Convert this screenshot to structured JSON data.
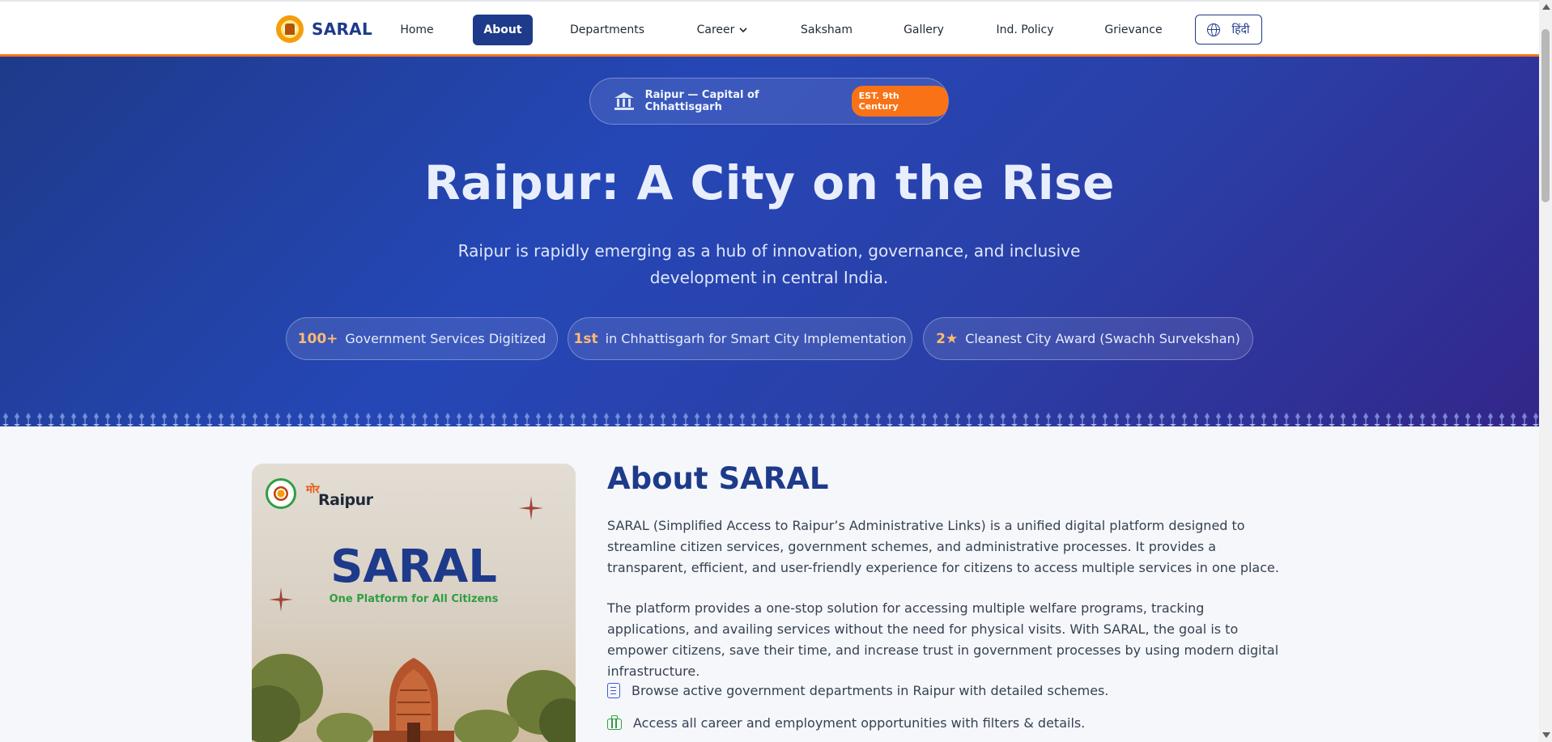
{
  "brand": {
    "name": "SARAL"
  },
  "nav": {
    "items": [
      {
        "label": "Home"
      },
      {
        "label": "About",
        "active": true
      },
      {
        "label": "Departments"
      },
      {
        "label": "Career",
        "has_dropdown": true
      },
      {
        "label": "Saksham"
      },
      {
        "label": "Gallery"
      },
      {
        "label": "Ind. Policy"
      },
      {
        "label": "Grievance"
      }
    ],
    "lang_button": {
      "label": "हिंदी",
      "icon": "globe-icon"
    }
  },
  "hero": {
    "badge_text": "Raipur — Capital of Chhattisgarh",
    "badge_pill": "EST. 9th Century",
    "badge_icon": "landmark-icon",
    "title": "Raipur: A City on the Rise",
    "subtitle": "Raipur is rapidly emerging as a hub of innovation, governance, and inclusive development in central India.",
    "stats": [
      {
        "value": "100+",
        "label": "Government Services Digitized"
      },
      {
        "value": "1st",
        "label": "in Chhattisgarh for Smart City Implementation"
      },
      {
        "value": "2★",
        "label": "Cleanest City Award (Swachh Survekshan)"
      }
    ]
  },
  "about": {
    "image": {
      "mor": "मोर",
      "raipur": "Raipur",
      "title": "SARAL",
      "tagline": "One Platform for All Citizens"
    },
    "title": "About SARAL",
    "paragraph1": "SARAL (Simplified Access to Raipur’s Administrative Links) is a unified digital platform designed to streamline citizen services, government schemes, and administrative processes. It provides a transparent, efficient, and user-friendly experience for citizens to access multiple services in one place.",
    "paragraph2": "The platform provides a one-stop solution for accessing multiple welfare programs, tracking applications, and availing services without the need for physical visits. With SARAL, the goal is to empower citizens, save their time, and increase trust in government processes by using modern digital infrastructure.",
    "features": [
      {
        "icon": "building-icon",
        "text": "Browse active government departments in Raipur with detailed schemes."
      },
      {
        "icon": "briefcase-icon",
        "text": "Access all career and employment opportunities with filters & details."
      }
    ]
  },
  "colors": {
    "primary": "#1e3a8a",
    "accent": "#f97316",
    "highlight": "#fdba74",
    "green": "#2f9e44"
  }
}
